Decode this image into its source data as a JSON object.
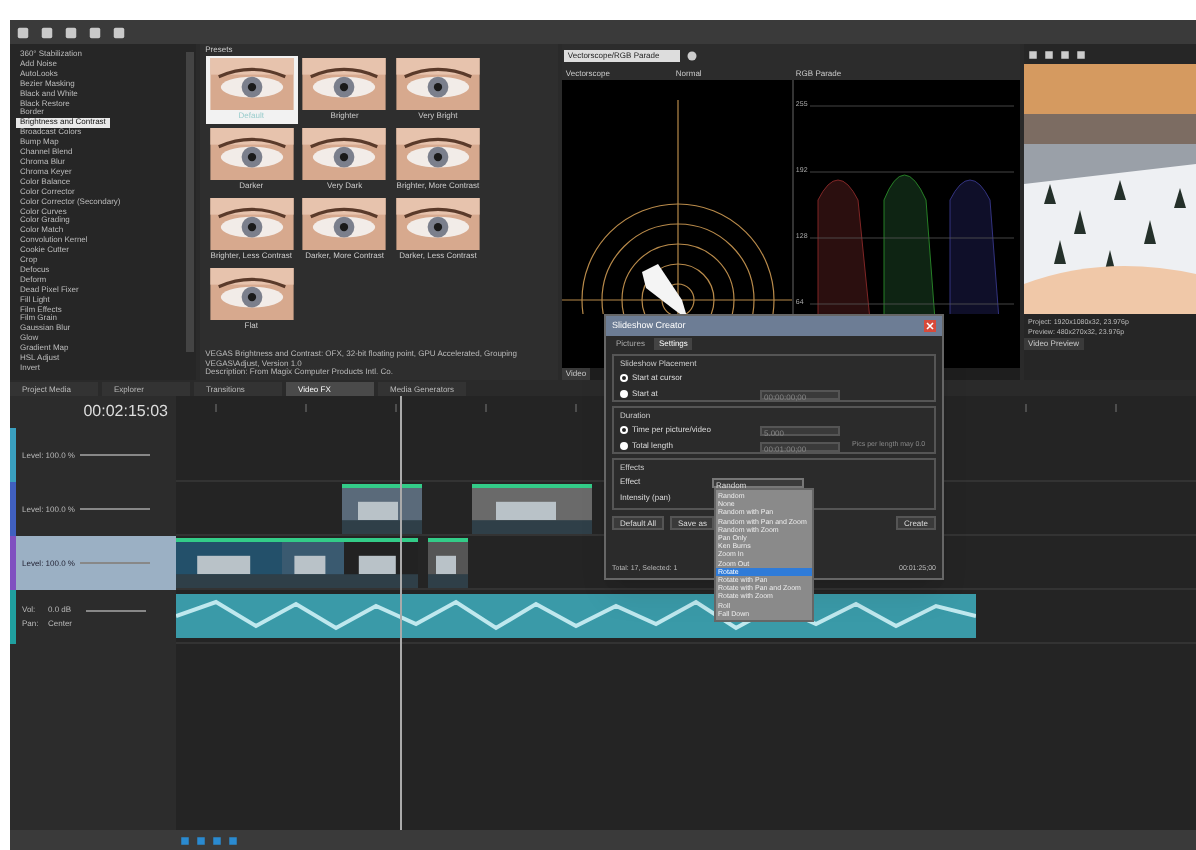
{
  "fx_list": {
    "items": [
      {
        "label": "360° Stabilization",
        "selected": false
      },
      {
        "label": "Add Noise",
        "selected": false
      },
      {
        "label": "AutoLooks",
        "selected": false
      },
      {
        "label": "Bezier Masking",
        "selected": false
      },
      {
        "label": "Black and White",
        "selected": false
      },
      {
        "label": "Black Restore",
        "selected": false
      },
      {
        "label": "Border",
        "selected": false
      },
      {
        "label": "Brightness and Contrast",
        "selected": true
      },
      {
        "label": "Broadcast Colors",
        "selected": false
      },
      {
        "label": "Bump Map",
        "selected": false
      },
      {
        "label": "Channel Blend",
        "selected": false
      },
      {
        "label": "Chroma Blur",
        "selected": false
      },
      {
        "label": "Chroma Keyer",
        "selected": false
      },
      {
        "label": "Color Balance",
        "selected": false
      },
      {
        "label": "Color Corrector",
        "selected": false
      },
      {
        "label": "Color Corrector (Secondary)",
        "selected": false
      },
      {
        "label": "Color Curves",
        "selected": false
      },
      {
        "label": "Color Grading",
        "selected": false
      },
      {
        "label": "Color Match",
        "selected": false
      },
      {
        "label": "Convolution Kernel",
        "selected": false
      },
      {
        "label": "Cookie Cutter",
        "selected": false
      },
      {
        "label": "Crop",
        "selected": false
      },
      {
        "label": "Defocus",
        "selected": false
      },
      {
        "label": "Deform",
        "selected": false
      },
      {
        "label": "Dead Pixel Fixer",
        "selected": false
      },
      {
        "label": "Fill Light",
        "selected": false
      },
      {
        "label": "Film Effects",
        "selected": false
      },
      {
        "label": "Film Grain",
        "selected": false
      },
      {
        "label": "Gaussian Blur",
        "selected": false
      },
      {
        "label": "Glow",
        "selected": false
      },
      {
        "label": "Gradient Map",
        "selected": false
      },
      {
        "label": "HSL Adjust",
        "selected": false
      },
      {
        "label": "Invert",
        "selected": false
      }
    ]
  },
  "presets": {
    "title": "Presets",
    "items": [
      {
        "label": "Default",
        "selected": true
      },
      {
        "label": "Brighter",
        "selected": false
      },
      {
        "label": "Very Bright",
        "selected": false
      },
      {
        "label": "Darker",
        "selected": false
      },
      {
        "label": "Very Dark",
        "selected": false
      },
      {
        "label": "Brighter, More Contrast",
        "selected": false
      },
      {
        "label": "Brighter, Less Contrast",
        "selected": false
      },
      {
        "label": "Darker, More Contrast",
        "selected": false
      },
      {
        "label": "Darker, Less Contrast",
        "selected": false
      },
      {
        "label": "Flat",
        "selected": false
      }
    ],
    "description": [
      "VEGAS Brightness and Contrast: OFX, 32-bit floating point, GPU Accelerated, Grouping VEGAS\\Adjust, Version 1.0",
      "Description: From Magix Computer Products Intl. Co."
    ]
  },
  "panel_tabs": [
    {
      "label": "Project Media",
      "selected": false
    },
    {
      "label": "Explorer",
      "selected": false
    },
    {
      "label": "Transitions",
      "selected": false
    },
    {
      "label": "Video FX",
      "selected": true
    },
    {
      "label": "Media Generators",
      "selected": false
    }
  ],
  "scopes": {
    "mode": "Vectorscope/RGB Parade",
    "left_title": "Vectorscope",
    "left_option": "Normal",
    "right_title": "RGB Parade",
    "scale": [
      "255",
      "192",
      "128",
      "64"
    ],
    "tab": "Video"
  },
  "preview": {
    "info": [
      "Project: 1920x1080x32, 23.976p",
      "Preview: 480x270x32, 23.976p"
    ],
    "tab": "Video Preview"
  },
  "timeline": {
    "timecode": "00:02:15:03",
    "tracks": [
      {
        "kind": "video",
        "level": "Level: 100.0 %",
        "selected": false
      },
      {
        "kind": "video",
        "level": "Level: 100.0 %",
        "selected": false
      },
      {
        "kind": "video",
        "level": "Level: 100.0 %",
        "selected": true
      },
      {
        "kind": "audio",
        "volume": "Vol:",
        "volume_value": "0.0 dB",
        "pan": "Pan:",
        "pan_value": "Center",
        "selected": false
      }
    ]
  },
  "dialog": {
    "title": "Slideshow Creator",
    "tabs": [
      {
        "label": "Pictures",
        "selected": false
      },
      {
        "label": "Settings",
        "selected": true
      }
    ],
    "placement": {
      "title": "Slideshow Placement",
      "options": [
        {
          "label": "Start at cursor",
          "selected": true
        },
        {
          "label": "Start at",
          "selected": false
        }
      ],
      "start_value": "00:00:00;00"
    },
    "duration": {
      "title": "Duration",
      "options": [
        {
          "label": "Time per picture/video",
          "selected": true
        },
        {
          "label": "Total length",
          "selected": false
        }
      ],
      "time_value": "5.000",
      "length_value": "00:01:00;00",
      "hint": "Pics per length may 0.0"
    },
    "effects": {
      "title": "Effects",
      "effect_label": "Effect",
      "effect_value": "Random",
      "intensity_label": "Intensity (pan)",
      "options": [
        {
          "label": "Random",
          "selected": false
        },
        {
          "label": "None",
          "selected": false
        },
        {
          "label": "Random with Pan",
          "selected": false
        },
        {
          "label": "Random with Pan and Zoom",
          "selected": false
        },
        {
          "label": "Random with Zoom",
          "selected": false
        },
        {
          "label": "Pan Only",
          "selected": false
        },
        {
          "label": "Ken Burns",
          "selected": false
        },
        {
          "label": "Zoom In",
          "selected": false
        },
        {
          "label": "Zoom Out",
          "selected": false
        },
        {
          "label": "Rotate",
          "selected": true
        },
        {
          "label": "Rotate with Pan",
          "selected": false
        },
        {
          "label": "Rotate with Pan and Zoom",
          "selected": false
        },
        {
          "label": "Rotate with Zoom",
          "selected": false
        },
        {
          "label": "Roll",
          "selected": false
        },
        {
          "label": "Fall Down",
          "selected": false
        }
      ]
    },
    "buttons": [
      "Default All",
      "Save as",
      "Create"
    ],
    "footer": "Total: 17, Selected: 1",
    "footer_time": "00:01:25;00"
  }
}
